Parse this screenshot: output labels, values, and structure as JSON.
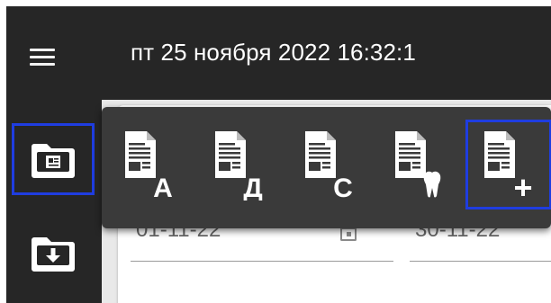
{
  "header": {
    "datetime": "пт 25 ноября 2022 16:32:1",
    "menu_icon": "hamburger-menu-icon"
  },
  "sidebar": {
    "items": [
      {
        "icon": "folder-document-icon",
        "active": true
      },
      {
        "icon": "folder-download-icon",
        "active": false
      }
    ]
  },
  "filters": {
    "date_from": "01-11-22",
    "date_to": "30-11-22",
    "calendar_icon": "calendar-icon"
  },
  "popup": {
    "items": [
      {
        "icon": "document-a-icon",
        "letter": "A",
        "active": false
      },
      {
        "icon": "document-d-icon",
        "letter": "Д",
        "active": false
      },
      {
        "icon": "document-c-icon",
        "letter": "C",
        "active": false
      },
      {
        "icon": "document-tooth-icon",
        "letter": "",
        "active": false
      },
      {
        "icon": "document-add-icon",
        "letter": "+",
        "active": true
      }
    ]
  },
  "colors": {
    "bar": "#262626",
    "popup": "#3a3a3a",
    "highlight": "#1f3de0",
    "icon": "#ffffff"
  }
}
